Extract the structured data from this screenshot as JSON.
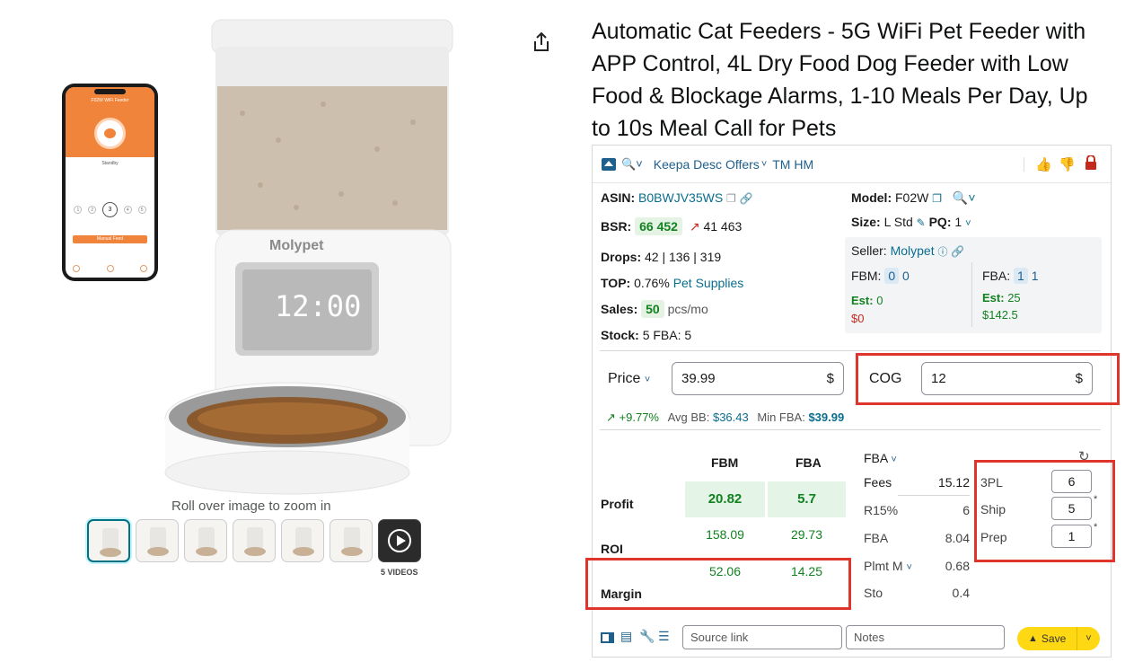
{
  "product": {
    "title": "Automatic Cat Feeders - 5G WiFi Pet Feeder with APP Control, 4L Dry Food Dog Feeder with Low Food & Blockage Alarms, 1-10 Meals Per Day, Up to 10s Meal Call for Pets",
    "rollover_text": "Roll over image to zoom in",
    "videos_label": "5 VIDEOS",
    "brand_on_device": "Molypet",
    "display_time": "12:00",
    "phone_title": "F02W WiFi Feeder",
    "phone_status": "Standby",
    "phone_button": "Manual Feed",
    "phone_numbers": [
      "1",
      "2",
      "3",
      "4",
      "5"
    ]
  },
  "toolbar": {
    "keepa_label": "Keepa Desc Offers",
    "tm_hm": "TM HM"
  },
  "info": {
    "asin_label": "ASIN:",
    "asin": "B0BWJV35WS",
    "bsr_label": "BSR:",
    "bsr": "66 452",
    "bsr_trend": "41 463",
    "drops_label": "Drops:",
    "drops": "42 | 136 | 319",
    "top_label": "TOP:",
    "top_pct": "0.76%",
    "top_category": "Pet Supplies",
    "sales_label": "Sales:",
    "sales": "50",
    "sales_unit": "pcs/mo",
    "stock_label": "Stock:",
    "stock": "5 FBA: 5",
    "model_label": "Model:",
    "model": "F02W",
    "size_label": "Size:",
    "size": "L Std",
    "pq_label": "PQ:",
    "pq": "1",
    "seller_label": "Seller:",
    "seller": "Molypet",
    "fbm_label": "FBM:",
    "fbm_count": "0",
    "fbm_count2": "0",
    "fbm_est_label": "Est:",
    "fbm_est": "0",
    "fbm_est_money": "$0",
    "fba_label": "FBA:",
    "fba_count": "1",
    "fba_count2": "1",
    "fba_est_label": "Est:",
    "fba_est": "25",
    "fba_est_money": "$142.5"
  },
  "pricing": {
    "price_label": "Price",
    "price_value": "39.99",
    "currency": "$",
    "cog_label": "COG",
    "cog_value": "12",
    "change": "+9.77%",
    "avg_bb_label": "Avg BB:",
    "avg_bb": "$36.43",
    "min_fba_label": "Min FBA:",
    "min_fba": "$39.99"
  },
  "profit_table": {
    "col_fbm": "FBM",
    "col_fba": "FBA",
    "profit_label": "Profit",
    "roi_label": "ROI",
    "margin_label": "Margin",
    "profit_fbm": "20.82",
    "profit_fba": "5.7",
    "roi_fbm": "158.09",
    "roi_fba": "29.73",
    "margin_fbm": "52.06",
    "margin_fba": "14.25"
  },
  "fees": {
    "mode": "FBA",
    "items": [
      {
        "label": "Fees",
        "value": "15.12"
      },
      {
        "label": "R15%",
        "value": "6"
      },
      {
        "label": "FBA",
        "value": "8.04"
      },
      {
        "label": "Plmt M",
        "value": "0.68"
      },
      {
        "label": "Sto",
        "value": "0.4"
      }
    ]
  },
  "extra_costs": {
    "items": [
      {
        "label": "3PL",
        "value": "6"
      },
      {
        "label": "Ship",
        "value": "5"
      },
      {
        "label": "Prep",
        "value": "1"
      }
    ]
  },
  "bottom": {
    "source_placeholder": "Source link",
    "notes_placeholder": "Notes",
    "save_label": "Save"
  },
  "colors": {
    "accent": "#1f5f8b",
    "green": "#12811f",
    "highlight_red": "#e0352b",
    "save_yellow": "#ffd814"
  }
}
